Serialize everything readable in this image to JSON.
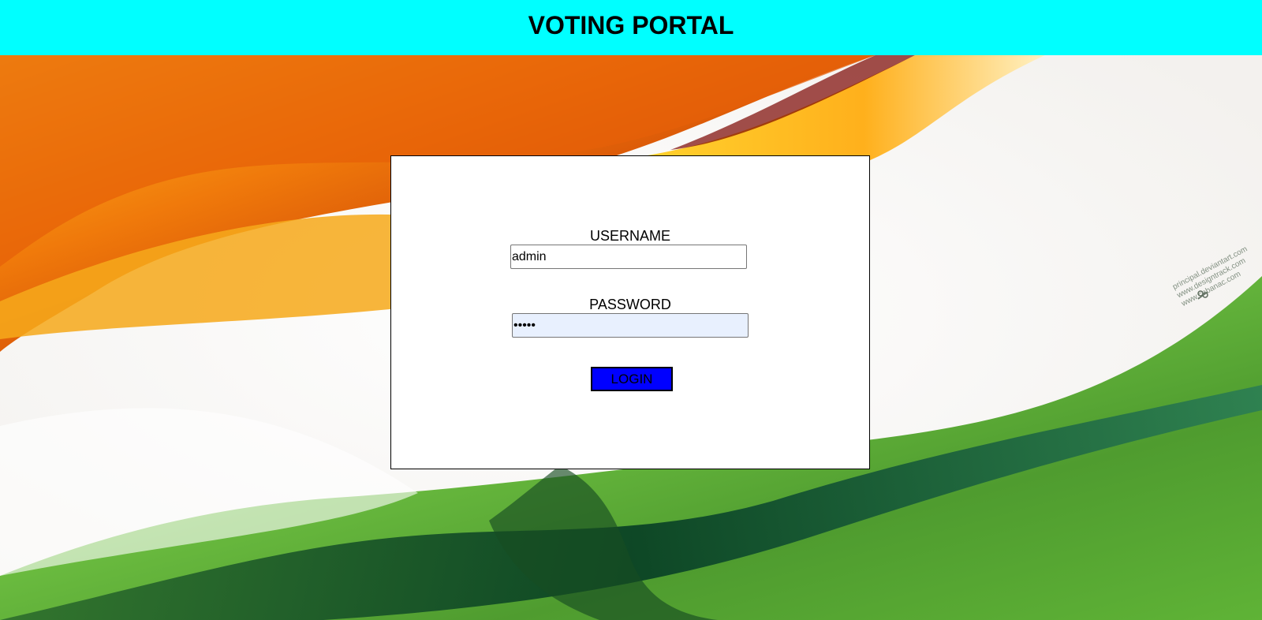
{
  "header": {
    "title": "VOTING PORTAL",
    "background_color": "#00ffff"
  },
  "background": {
    "description_colors": {
      "saffron": "#f07a0b",
      "white": "#fbfbf6",
      "green": "#5fb336"
    },
    "watermark_lines": [
      "principal.deviantart.com",
      "www.designtrack.com",
      "www.cabanac.com"
    ]
  },
  "login_form": {
    "username_label": "USERNAME",
    "username_value": "admin",
    "password_label": "PASSWORD",
    "password_value": "admin",
    "login_button_label": "LOGIN",
    "button_color": "#0000ff",
    "password_field_color": "#e8f0fe"
  }
}
